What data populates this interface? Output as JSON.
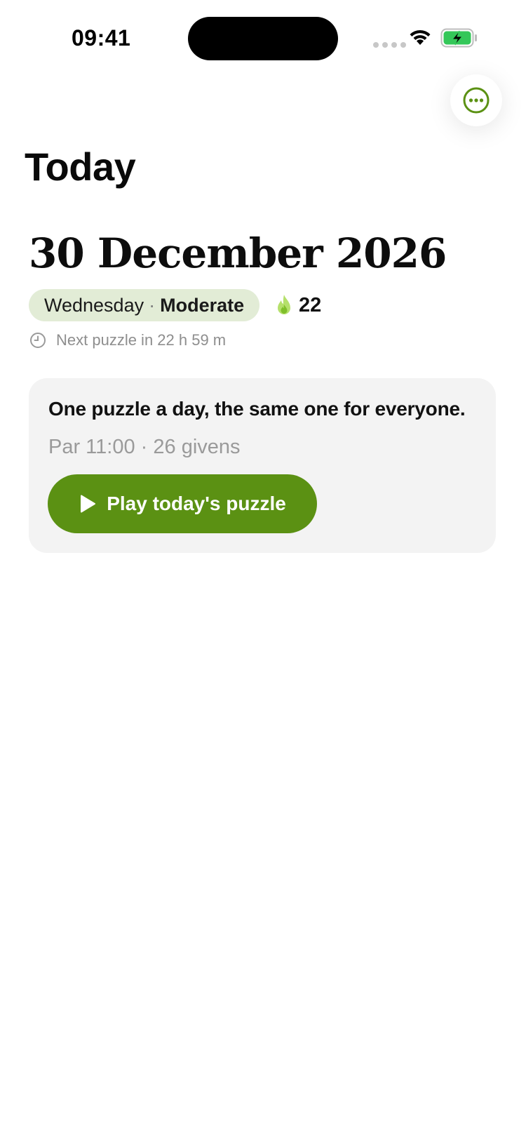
{
  "status_bar": {
    "time": "09:41"
  },
  "header": {
    "title": "Today",
    "more_icon": "ellipsis-circle-icon"
  },
  "puzzle_info": {
    "date": "30 December 2026",
    "weekday": "Wednesday",
    "separator": "·",
    "difficulty": "Moderate",
    "streak_icon": "flame-icon",
    "streak_count": "22",
    "next_puzzle_text": "Next puzzle in 22 h 59 m"
  },
  "card": {
    "headline": "One puzzle a day, the same one for everyone.",
    "meta": "Par 11:00 · 26 givens",
    "play_label": "Play today's puzzle",
    "play_icon": "play-icon"
  },
  "colors": {
    "accent_green": "#5b9113",
    "pill_background": "#e2ecd6",
    "card_background": "#f3f3f3",
    "flame_light": "#b5e06b",
    "flame_dark": "#7fbf2a"
  }
}
